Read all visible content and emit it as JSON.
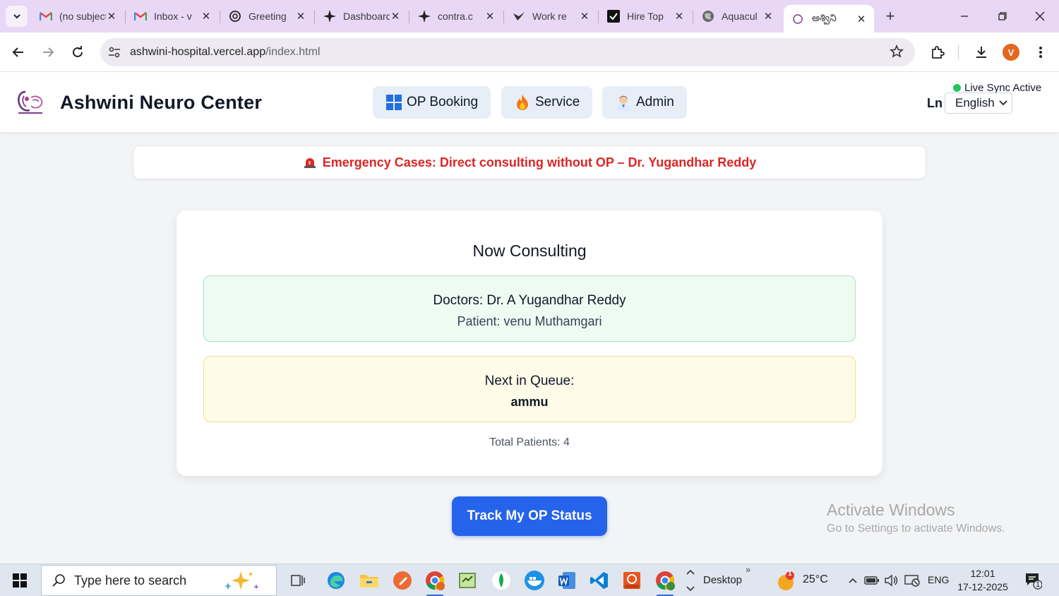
{
  "browser": {
    "tabs": [
      {
        "title": "(no subject)",
        "icon": "gmail-icon",
        "left": 0
      },
      {
        "title": "Inbox - v",
        "icon": "gmail-icon"
      },
      {
        "title": "Greeting",
        "icon": "openai-icon"
      },
      {
        "title": "Dashboard",
        "icon": "star4-icon"
      },
      {
        "title": "contra.c",
        "icon": "star4-icon"
      },
      {
        "title": "Work re",
        "icon": "bird-icon"
      },
      {
        "title": "Hire Top",
        "icon": "check-icon"
      },
      {
        "title": "Aquacul",
        "icon": "globe-icon"
      },
      {
        "title": "అశ్విని",
        "icon": "hospital-logo-icon"
      }
    ],
    "url_host": "ashwini-hospital.vercel.app",
    "url_path": "/index.html",
    "profile_initial": "V"
  },
  "site": {
    "brand": "Ashwini Neuro Center",
    "nav": [
      {
        "label": "OP Booking",
        "icon": "windows-grid-icon"
      },
      {
        "label": "Service",
        "icon": "fire-icon"
      },
      {
        "label": "Admin",
        "icon": "doctor-icon"
      }
    ],
    "sync_status": "Live Sync Active",
    "language_label": "Ln",
    "language_value": "English"
  },
  "emergency": {
    "text": "Emergency Cases: Direct consulting without OP – Dr. Yugandhar Reddy",
    "icon": "siren-icon",
    "color": "#dc2626"
  },
  "consulting": {
    "title": "Now Consulting",
    "doctor_line": "Doctors: Dr. A Yugandhar Reddy",
    "patient_line": "Patient: venu Muthamgari",
    "next_label": "Next in Queue:",
    "next_name": "ammu",
    "total_line": "Total Patients: 4"
  },
  "track_button": {
    "label": "Track My OP Status",
    "color": "#2563eb"
  },
  "watermark": {
    "title": "Activate Windows",
    "subtitle": "Go to Settings to activate Windows."
  },
  "taskbar": {
    "search_placeholder": "Type here to search",
    "desktop_label": "Desktop",
    "temperature": "25°C",
    "weather_badge": "1",
    "language": "ENG",
    "time": "12:01",
    "date": "17-12-2025",
    "notification_count": "1"
  }
}
